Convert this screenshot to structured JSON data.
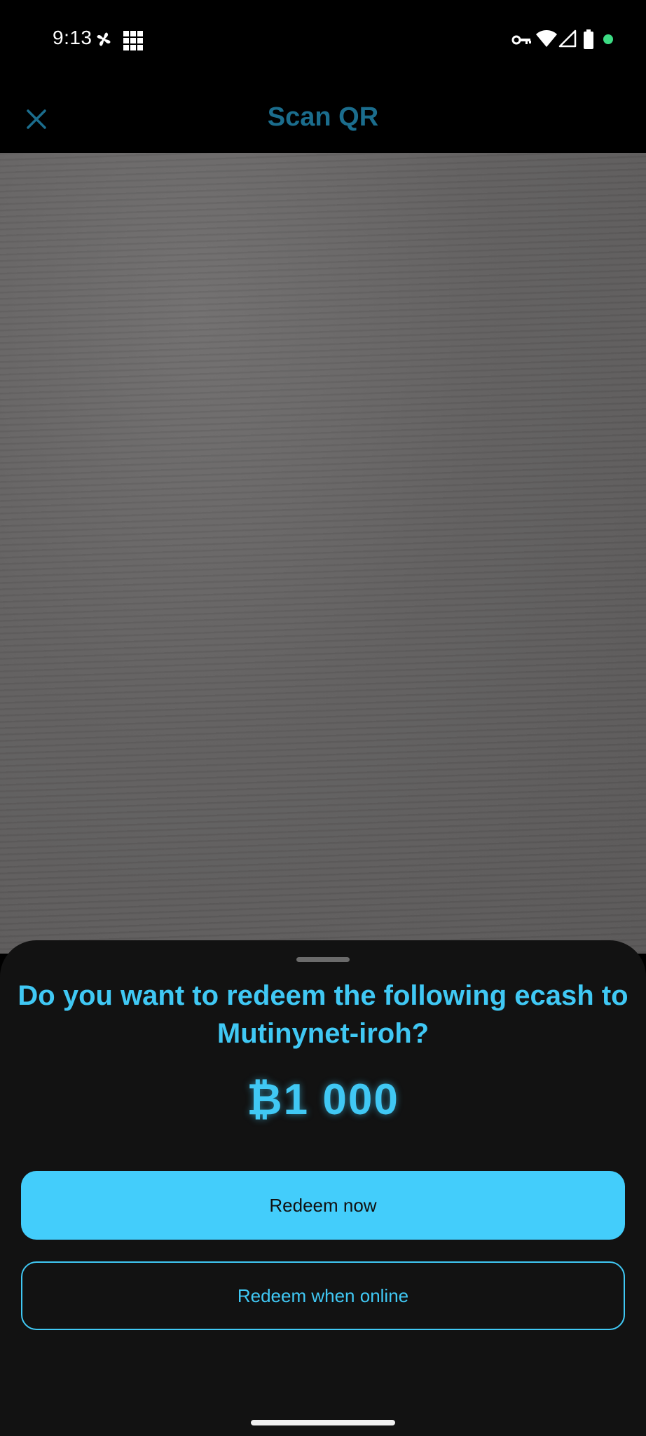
{
  "status_bar": {
    "time": "9:13",
    "icons": [
      "fan-icon",
      "grid-app-icon",
      "vpn-key-icon",
      "wifi-icon",
      "cellular-signal-icon",
      "battery-icon",
      "privacy-dot-icon"
    ],
    "privacy_dot_color": "#3ddc84"
  },
  "app_bar": {
    "close_icon": "close-icon",
    "title": "Scan QR",
    "title_color": "#1b6d8d"
  },
  "camera_view": {
    "icon": "camera-preview"
  },
  "sheet": {
    "question_line1": "Do you want to redeem the following ecash to",
    "question_line2": "Mutinynet-iroh?",
    "amount": "₿1 000",
    "primary_button": "Redeem now",
    "secondary_button": "Redeem when online",
    "accent_color": "#43cdfb",
    "background_color": "#121212"
  }
}
